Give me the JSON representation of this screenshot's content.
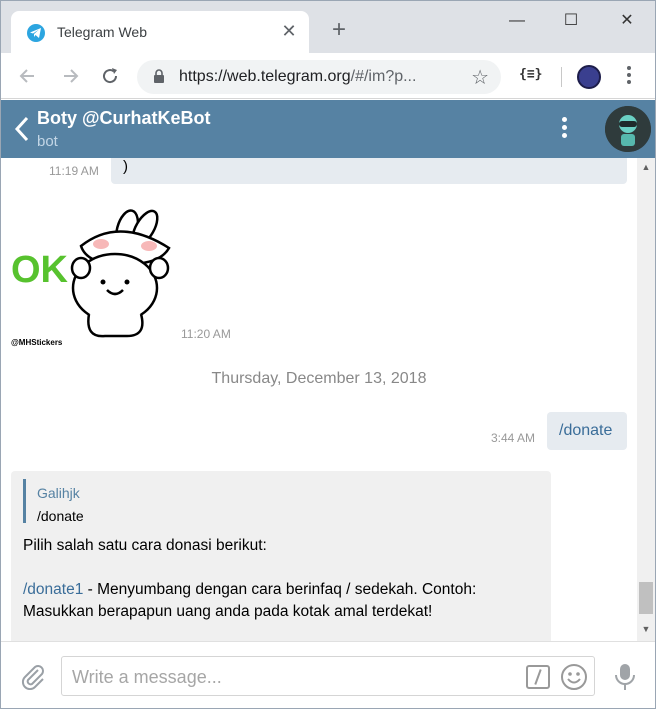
{
  "browser": {
    "tab_title": "Telegram Web",
    "tab_close": "✕",
    "new_tab": "+",
    "url_host": "https://web.telegram.org",
    "url_path": "/#/im?p...",
    "ext_label": "{≡}",
    "window_min": "—",
    "window_max": "☐",
    "window_close": "✕"
  },
  "chat": {
    "name": "Boty @CurhatKeBot",
    "status": "bot"
  },
  "messages": {
    "prev_text": ")",
    "prev_time": "11:19 AM",
    "sticker_time": "11:20 AM",
    "sticker_credit": "@MHStickers",
    "sticker_text": "OK",
    "date_separator": "Thursday, December 13, 2018",
    "out_text": "/donate",
    "out_time": "3:44 AM",
    "reply_name": "Galihjk",
    "reply_text": "/donate",
    "in_line1": "Pilih salah satu cara donasi berikut:",
    "in_link": "/donate1",
    "in_line3_rest": " - Menyumbang dengan cara berinfaq / sedekah. Contoh:",
    "in_line4": "Masukkan berapapun uang anda pada kotak amal terdekat!"
  },
  "composer": {
    "placeholder": "Write a message..."
  },
  "colors": {
    "header_bg": "#5682a3",
    "link": "#3a6d99",
    "bubble_out": "#e6ebf0",
    "bubble_in": "#f0f0f0"
  },
  "icons": [
    "telegram-favicon",
    "back-arrow-icon",
    "forward-arrow-icon",
    "reload-icon",
    "lock-icon",
    "star-icon",
    "kebab-menu-icon",
    "paperclip-icon",
    "slash-command-icon",
    "emoji-icon",
    "microphone-icon"
  ]
}
